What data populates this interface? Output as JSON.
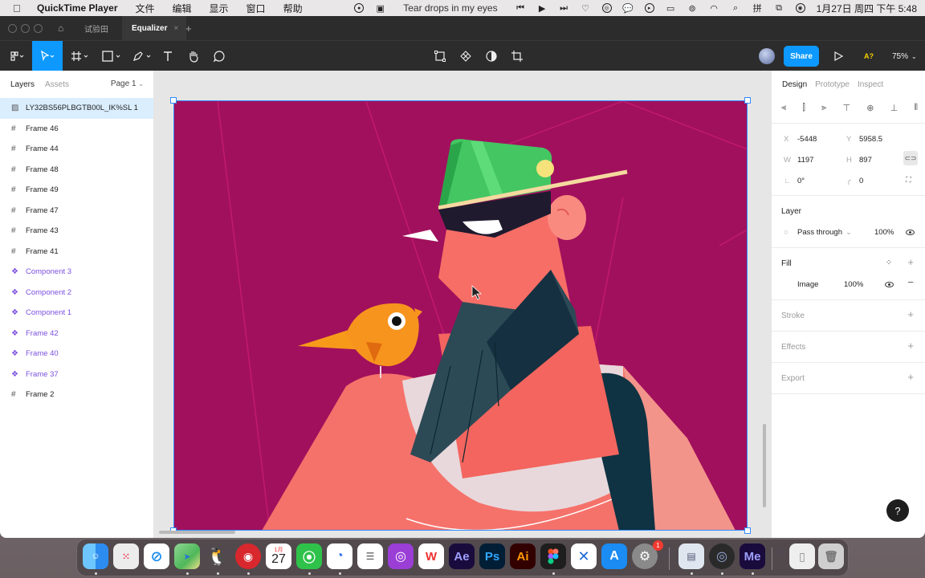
{
  "menubar": {
    "app_name": "QuickTime Player",
    "items": [
      "文件",
      "编辑",
      "显示",
      "窗口",
      "帮助"
    ],
    "song": "Tear drops in my eyes",
    "datetime": "1月27日 周四 下午 5:48"
  },
  "window": {
    "tabs": [
      {
        "label": "试验田"
      },
      {
        "label": "Equalizer"
      }
    ],
    "tab_close": "×",
    "tab_add": "+"
  },
  "toolbar": {
    "share_label": "Share",
    "zoom": "75%",
    "a_label": "A?"
  },
  "left_panel": {
    "tabs": [
      "Layers",
      "Assets"
    ],
    "page_label": "Page 1",
    "layers": [
      {
        "name": "LY32BS56PLBGTB00L_IK%SL 1",
        "kind": "image"
      },
      {
        "name": "Frame 46",
        "kind": "frame"
      },
      {
        "name": "Frame 44",
        "kind": "frame"
      },
      {
        "name": "Frame 48",
        "kind": "frame"
      },
      {
        "name": "Frame 49",
        "kind": "frame"
      },
      {
        "name": "Frame 47",
        "kind": "frame"
      },
      {
        "name": "Frame 43",
        "kind": "frame"
      },
      {
        "name": "Frame 41",
        "kind": "frame"
      },
      {
        "name": "Component 3",
        "kind": "component"
      },
      {
        "name": "Component 2",
        "kind": "component"
      },
      {
        "name": "Component 1",
        "kind": "component"
      },
      {
        "name": "Frame 42",
        "kind": "component"
      },
      {
        "name": "Frame 40",
        "kind": "component"
      },
      {
        "name": "Frame 37",
        "kind": "component"
      },
      {
        "name": "Frame 2",
        "kind": "frame"
      }
    ]
  },
  "right_panel": {
    "tabs": [
      "Design",
      "Prototype",
      "Inspect"
    ],
    "x_label": "X",
    "x": "-5448",
    "y_label": "Y",
    "y": "5958.5",
    "w_label": "W",
    "w": "1197",
    "h_label": "H",
    "h": "897",
    "rotation": "0°",
    "radius": "0",
    "layer_title": "Layer",
    "blend_mode": "Pass through",
    "layer_opacity": "100%",
    "fill_title": "Fill",
    "fill_type": "Image",
    "fill_opacity": "100%",
    "stroke_title": "Stroke",
    "effects_title": "Effects",
    "export_title": "Export"
  },
  "help_label": "?",
  "dock": {
    "calendar_month": "1月",
    "calendar_day": "27",
    "notification_badge": "1",
    "apps": [
      {
        "name": "Finder",
        "color": "#2d8cf0"
      },
      {
        "name": "Launchpad",
        "color": "#e7e7e7"
      },
      {
        "name": "Safari",
        "color": "#1b8ef0"
      },
      {
        "name": "Maps",
        "color": "#4fb85a"
      },
      {
        "name": "QQ",
        "color": "#111111"
      },
      {
        "name": "NetEase Music",
        "color": "#d9272e"
      },
      {
        "name": "Calendar",
        "color": "#ffffff"
      },
      {
        "name": "WeChat",
        "color": "#2fc24a"
      },
      {
        "name": "Lark",
        "color": "#ffffff"
      },
      {
        "name": "Reminders",
        "color": "#ffffff"
      },
      {
        "name": "Podcasts",
        "color": "#9a3ed6"
      },
      {
        "name": "WPS",
        "color": "#ffffff"
      },
      {
        "name": "After Effects",
        "color": "#1a0b3d"
      },
      {
        "name": "Photoshop",
        "color": "#001e36"
      },
      {
        "name": "Illustrator",
        "color": "#330000"
      },
      {
        "name": "Figma",
        "color": "#1e1e1e"
      },
      {
        "name": "Xcode",
        "color": "#ffffff"
      },
      {
        "name": "App Store",
        "color": "#1a8cf4"
      },
      {
        "name": "System Preferences",
        "color": "#8a8a8a"
      },
      {
        "name": "Preview",
        "color": "#dfe6ef"
      },
      {
        "name": "QuickTime",
        "color": "#2a2a2a"
      },
      {
        "name": "Media Encoder",
        "color": "#1a0b3d"
      },
      {
        "name": "Document",
        "color": "#eeeeee"
      },
      {
        "name": "Trash",
        "color": "#cfcfcf"
      }
    ]
  },
  "colors": {
    "accent": "#0d99ff",
    "artboard_bg": "#a1105d",
    "component": "#7b4fe0"
  }
}
